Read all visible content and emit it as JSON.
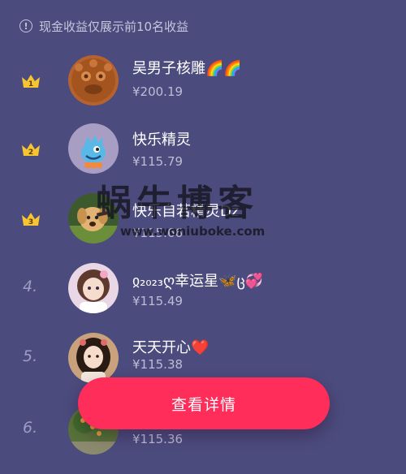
{
  "notice": {
    "icon": "info-circle-icon",
    "text": "现金收益仅展示前10名收益"
  },
  "leaderboard": [
    {
      "rank": "1",
      "rank_style": "crown",
      "name": "吴男子核雕🌈🌈",
      "amount": "¥200.19",
      "avatar": "carved-lion-avatar"
    },
    {
      "rank": "2",
      "rank_style": "crown",
      "name": "快乐精灵",
      "amount": "¥115.79",
      "avatar": "cartoon-monster-avatar"
    },
    {
      "rank": "3",
      "rank_style": "crown",
      "name": "快乐自若精灵Dz",
      "amount": "¥115.66",
      "avatar": "dog-photo-avatar"
    },
    {
      "rank": "4.",
      "rank_style": "number",
      "name": "ჲ₂₀₂₃ღ幸运星🦋ც💞",
      "amount": "¥115.49",
      "avatar": "doll-girl-avatar"
    },
    {
      "rank": "5.",
      "rank_style": "number",
      "name": "天天开心❤️",
      "amount": "¥115.38",
      "avatar": "hanfu-girl-avatar"
    },
    {
      "rank": "6.",
      "rank_style": "number",
      "name": "",
      "amount": "¥115.36",
      "avatar": "fruit-tree-avatar"
    }
  ],
  "button": {
    "label": "查看详情"
  },
  "watermark": {
    "title": "蜗牛博客",
    "url": "www.woniuboke.com"
  },
  "colors": {
    "background": "#4b4b7d",
    "accent_button": "#ff2d5a",
    "crown": "#f6c531",
    "muted_text": "#bdbdd6"
  }
}
